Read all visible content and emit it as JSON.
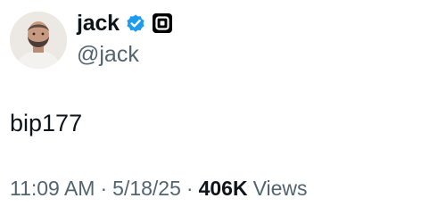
{
  "author": {
    "display_name": "jack",
    "handle": "@jack",
    "verified_badge_icon": "verified-check-icon",
    "affiliate_badge_icon": "square-logo-icon",
    "verified_color": "#1d9bf0"
  },
  "tweet": {
    "text": "bip177"
  },
  "meta": {
    "time": "11:09 AM",
    "separator": "·",
    "date": "5/18/25",
    "views_count": "406K",
    "views_label": "Views"
  },
  "colors": {
    "primary_text": "#0f1419",
    "secondary_text": "#536471"
  }
}
